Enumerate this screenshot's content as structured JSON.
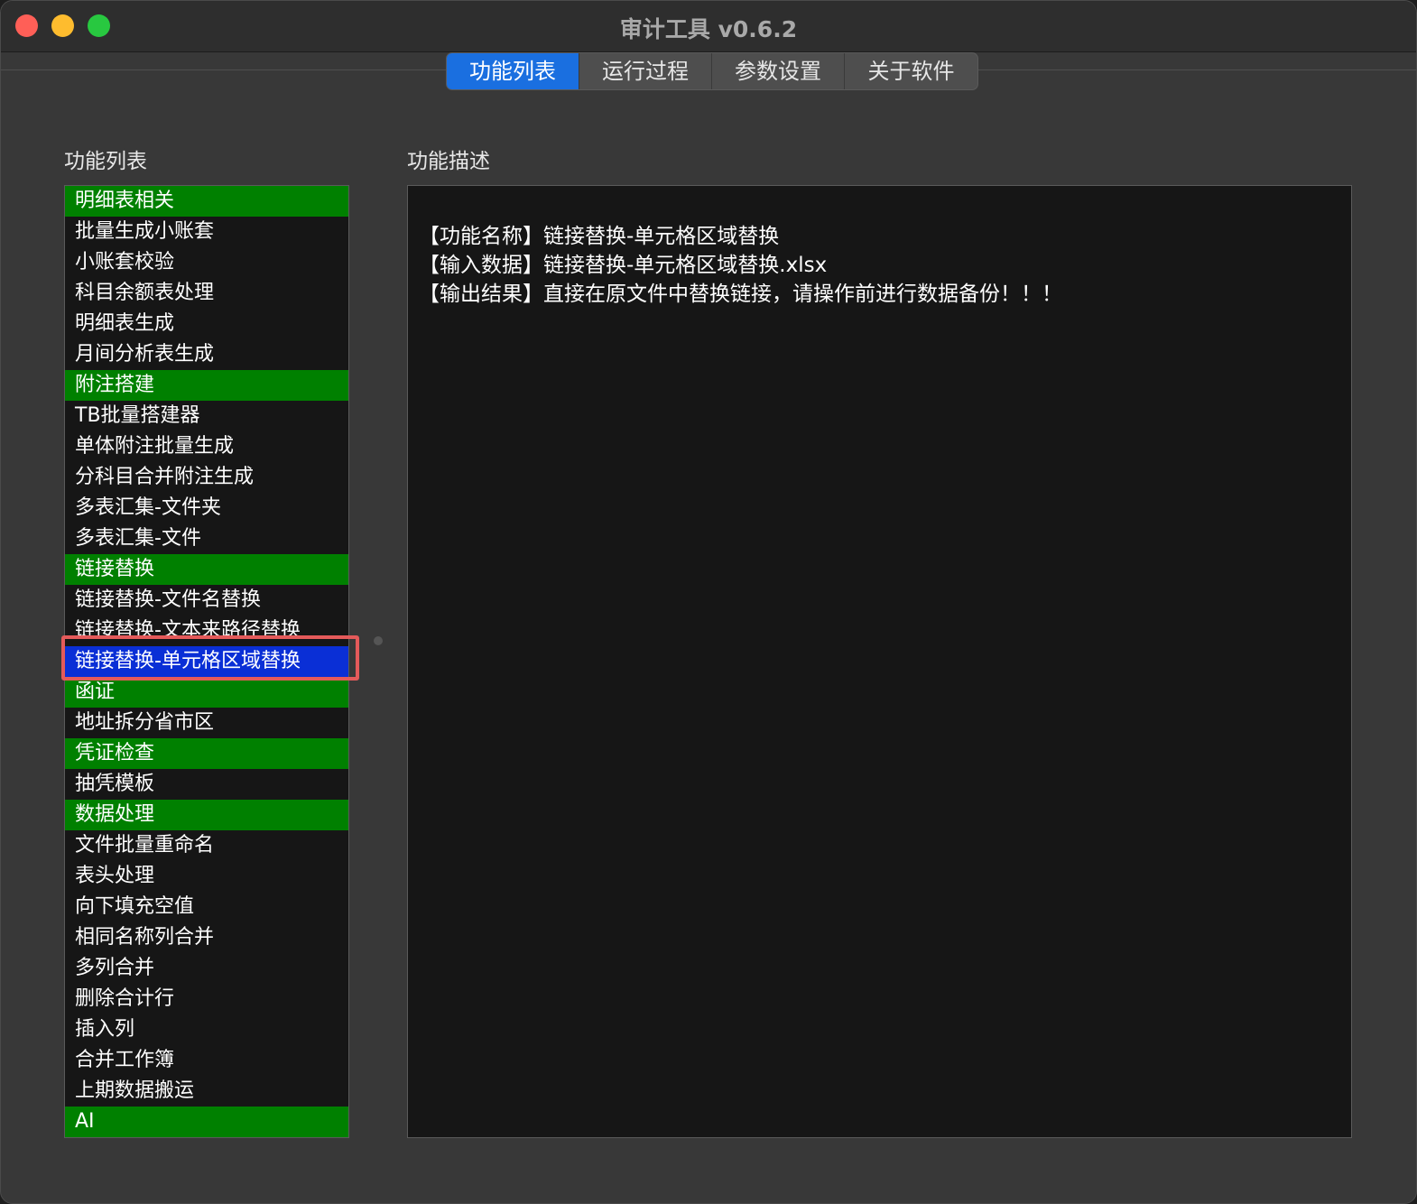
{
  "window": {
    "title": "审计工具 v0.6.2"
  },
  "tabs": [
    {
      "label": "功能列表",
      "active": true
    },
    {
      "label": "运行过程",
      "active": false
    },
    {
      "label": "参数设置",
      "active": false
    },
    {
      "label": "关于软件",
      "active": false
    }
  ],
  "left_panel": {
    "label": "功能列表",
    "items": [
      {
        "label": "明细表相关",
        "type": "header"
      },
      {
        "label": "批量生成小账套",
        "type": "item"
      },
      {
        "label": "小账套校验",
        "type": "item"
      },
      {
        "label": "科目余额表处理",
        "type": "item"
      },
      {
        "label": "明细表生成",
        "type": "item"
      },
      {
        "label": "月间分析表生成",
        "type": "item"
      },
      {
        "label": "附注搭建",
        "type": "header"
      },
      {
        "label": "TB批量搭建器",
        "type": "item"
      },
      {
        "label": "单体附注批量生成",
        "type": "item"
      },
      {
        "label": "分科目合并附注生成",
        "type": "item"
      },
      {
        "label": "多表汇集-文件夹",
        "type": "item"
      },
      {
        "label": "多表汇集-文件",
        "type": "item"
      },
      {
        "label": "链接替换",
        "type": "header"
      },
      {
        "label": "链接替换-文件名替换",
        "type": "item"
      },
      {
        "label": "链接替换-文本来路径替换",
        "type": "item"
      },
      {
        "label": "链接替换-单元格区域替换",
        "type": "selected"
      },
      {
        "label": "函证",
        "type": "header"
      },
      {
        "label": "地址拆分省市区",
        "type": "item"
      },
      {
        "label": "凭证检查",
        "type": "header"
      },
      {
        "label": "抽凭模板",
        "type": "item"
      },
      {
        "label": "数据处理",
        "type": "header"
      },
      {
        "label": "文件批量重命名",
        "type": "item"
      },
      {
        "label": "表头处理",
        "type": "item"
      },
      {
        "label": "向下填充空值",
        "type": "item"
      },
      {
        "label": "相同名称列合并",
        "type": "item"
      },
      {
        "label": "多列合并",
        "type": "item"
      },
      {
        "label": "删除合计行",
        "type": "item"
      },
      {
        "label": "插入列",
        "type": "item"
      },
      {
        "label": "合并工作簿",
        "type": "item"
      },
      {
        "label": "上期数据搬运",
        "type": "item"
      },
      {
        "label": "AI",
        "type": "header"
      }
    ]
  },
  "right_panel": {
    "label": "功能描述",
    "lines": [
      "【功能名称】链接替换-单元格区域替换",
      "【输入数据】链接替换-单元格区域替换.xlsx",
      "【输出结果】直接在原文件中替换链接，请操作前进行数据备份！！！"
    ]
  }
}
